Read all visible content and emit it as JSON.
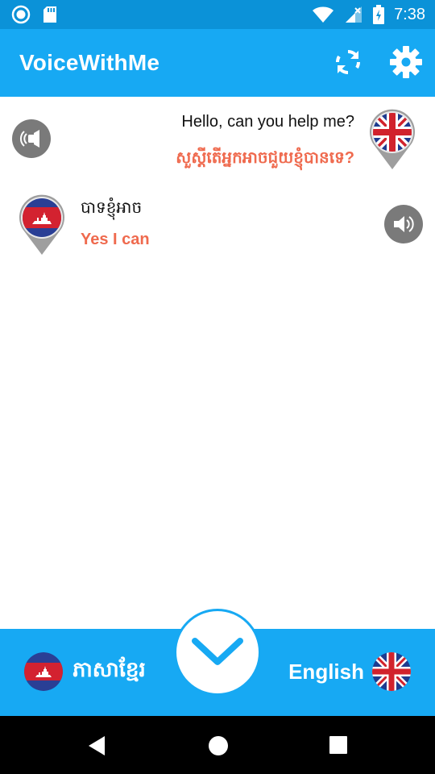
{
  "status": {
    "time": "7:38"
  },
  "app": {
    "title": "VoiceWithMe"
  },
  "icons": {
    "refresh": "refresh-icon",
    "settings": "gear-icon",
    "speaker": "speaker-icon",
    "uk_flag": "uk-flag-icon",
    "cambodia_flag": "cambodia-flag-icon",
    "chevron": "chevron-down-icon"
  },
  "messages": [
    {
      "text": "Hello, can you help me?",
      "translation": "សួស្តីតើអ្នកអាចជួយខ្ញុំបានទេ?"
    },
    {
      "text": "បាទខ្ញុំអាច",
      "translation": "Yes I can"
    }
  ],
  "languages": {
    "left": "ភាសាខ្មែរ",
    "right": "English"
  },
  "colors": {
    "primary": "#17a9f3",
    "statusbar": "#0b92d8",
    "translation": "#ef6a4e",
    "speaker": "#7a7a7a"
  }
}
